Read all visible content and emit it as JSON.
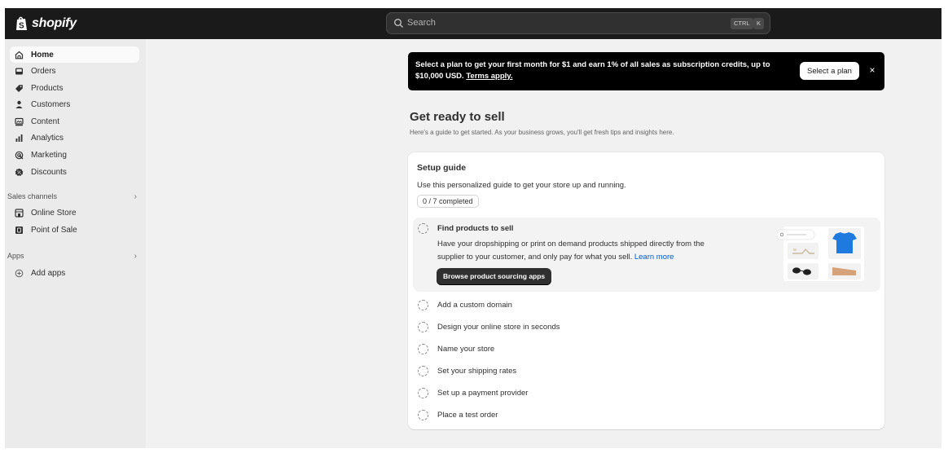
{
  "topbar": {
    "logo_text": "shopify",
    "search_placeholder": "Search",
    "shortcut_ctrl": "CTRL",
    "shortcut_k": "K"
  },
  "sidebar": {
    "items": [
      {
        "label": "Home",
        "icon": "home-icon",
        "active": true
      },
      {
        "label": "Orders",
        "icon": "inbox-icon"
      },
      {
        "label": "Products",
        "icon": "tag-icon"
      },
      {
        "label": "Customers",
        "icon": "person-icon"
      },
      {
        "label": "Content",
        "icon": "image-icon"
      },
      {
        "label": "Analytics",
        "icon": "bar-chart-icon"
      },
      {
        "label": "Marketing",
        "icon": "target-icon"
      },
      {
        "label": "Discounts",
        "icon": "discount-icon"
      }
    ],
    "sales_channels": {
      "label": "Sales channels",
      "items": [
        {
          "label": "Online Store",
          "icon": "store-icon"
        },
        {
          "label": "Point of Sale",
          "icon": "pos-icon"
        }
      ]
    },
    "apps": {
      "label": "Apps",
      "items": [
        {
          "label": "Add apps",
          "icon": "plus-circle-icon"
        }
      ]
    }
  },
  "banner": {
    "text": "Select a plan to get your first month for $1 and earn 1% of all sales as subscription credits, up to $10,000 USD.",
    "link_text": "Terms apply.",
    "button_label": "Select a plan",
    "close_label": "×"
  },
  "page": {
    "title": "Get ready to sell",
    "subtitle": "Here's a guide to get started. As your business grows, you'll get fresh tips and insights here."
  },
  "setup_guide": {
    "title": "Setup guide",
    "description": "Use this personalized guide to get your store up and running.",
    "progress": "0 / 7 completed",
    "completed": 0,
    "total": 7,
    "active_task": {
      "title": "Find products to sell",
      "description": "Have your dropshipping or print on demand products shipped directly from the supplier to your customer, and only pay for what you sell.",
      "link_text": "Learn more",
      "button_label": "Browse product sourcing apps"
    },
    "tasks": [
      "Add a custom domain",
      "Design your online store in seconds",
      "Name your store",
      "Set your shipping rates",
      "Set up a payment provider",
      "Place a test order"
    ]
  },
  "colors": {
    "topbar_bg": "#1a1a1a",
    "sidebar_bg": "#ebebeb",
    "main_bg": "#f1f1f1",
    "link": "#005bd3",
    "shirt": "#1f7ae0"
  }
}
